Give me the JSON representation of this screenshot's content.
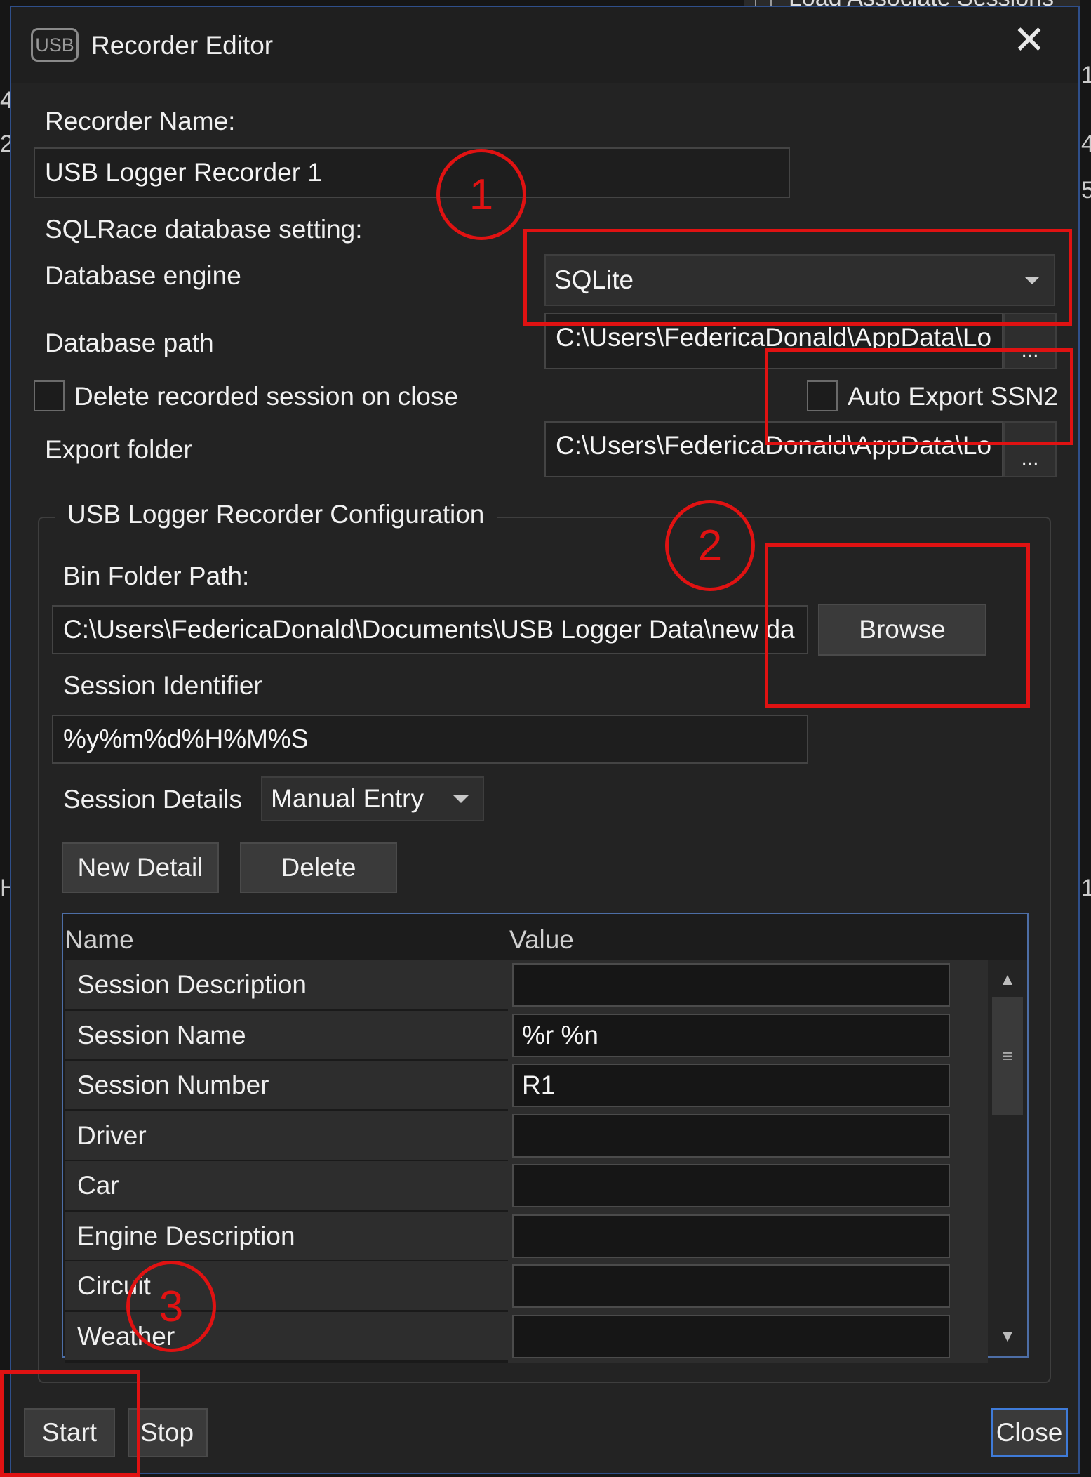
{
  "background": {
    "top_text": "Load Associate Sessions",
    "right_edge_chars": [
      "1",
      "4",
      "5",
      "1"
    ],
    "left_edge_chars": [
      "4",
      "2",
      "H"
    ]
  },
  "dialog": {
    "icon_text": "USB",
    "title": "Recorder Editor"
  },
  "recorder": {
    "name_label": "Recorder Name:",
    "name_value": "USB Logger Recorder 1",
    "sqlrace_label": "SQLRace database setting:",
    "engine_label": "Database engine",
    "engine_value": "SQLite",
    "path_label": "Database path",
    "path_value": "C:\\Users\\FedericaDonald\\AppData\\Lo",
    "delete_label": "Delete recorded session on close",
    "auto_export_label": "Auto Export SSN2",
    "export_label": "Export folder",
    "export_value": "C:\\Users\\FedericaDonald\\AppData\\Lo",
    "ellipsis": "..."
  },
  "config": {
    "group_title": "USB Logger Recorder Configuration",
    "bin_label": "Bin Folder Path:",
    "bin_value": "C:\\Users\\FedericaDonald\\Documents\\USB Logger Data\\new da",
    "browse_label": "Browse",
    "session_id_label": "Session Identifier",
    "session_id_value": "%y%m%d%H%M%S",
    "session_details_label": "Session Details",
    "session_details_value": "Manual Entry",
    "new_detail_label": "New Detail",
    "delete_label": "Delete"
  },
  "grid": {
    "col_name": "Name",
    "col_value": "Value",
    "rows": [
      {
        "name": "Session Description",
        "value": ""
      },
      {
        "name": "Session Name",
        "value": "%r %n"
      },
      {
        "name": "Session Number",
        "value": "R1"
      },
      {
        "name": "Driver",
        "value": ""
      },
      {
        "name": "Car",
        "value": ""
      },
      {
        "name": "Engine Description",
        "value": ""
      },
      {
        "name": "Circuit",
        "value": ""
      },
      {
        "name": "Weather",
        "value": ""
      }
    ]
  },
  "footer": {
    "start_label": "Start",
    "stop_label": "Stop",
    "close_label": "Close"
  },
  "annotations": {
    "marker_1": "1",
    "marker_2": "2",
    "marker_3": "3",
    "color": "#e01212"
  }
}
